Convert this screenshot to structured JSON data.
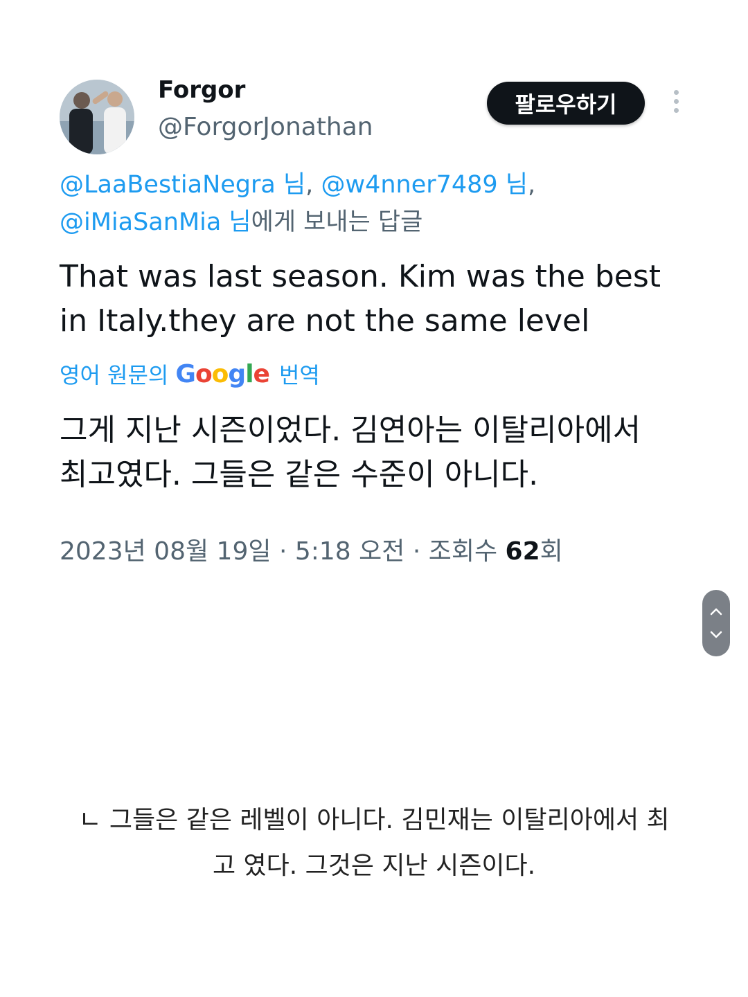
{
  "tweet": {
    "author": {
      "name": "Forgor",
      "handle": "@ForgorJonathan"
    },
    "follow_label": "팔로우하기",
    "reply_to": {
      "mentions": [
        "@LaaBestiaNegra 님",
        "@w4nner7489 님",
        "@iMiaSanMia 님"
      ],
      "separator": ", ",
      "suffix": "에게 보내는 답글"
    },
    "text_line1": "That was last season. Kim was the best",
    "text_line2": "in Italy.they are not the same level",
    "translate": {
      "prefix": "영어 원문의",
      "brand": "Google",
      "suffix": "번역"
    },
    "translated_line1": "그게 지난 시즌이었다. 김연아는 이탈리아에서",
    "translated_line2": "최고였다. 그들은 같은 수준이 아니다.",
    "meta": {
      "date": "2023년 08월 19일",
      "time": "5:18 오전",
      "views_label": "조회수",
      "views_count": "62",
      "views_unit": "회"
    }
  },
  "caption": {
    "line1": "ㄴ 그들은 같은 레벨이 아니다. 김민재는 이탈리아에서 최",
    "line2": "고 였다. 그것은 지난 시즌이다."
  },
  "icons": {
    "more": "more-vertical-icon",
    "scroll_up": "chevron-up-icon",
    "scroll_down": "chevron-down-icon"
  }
}
